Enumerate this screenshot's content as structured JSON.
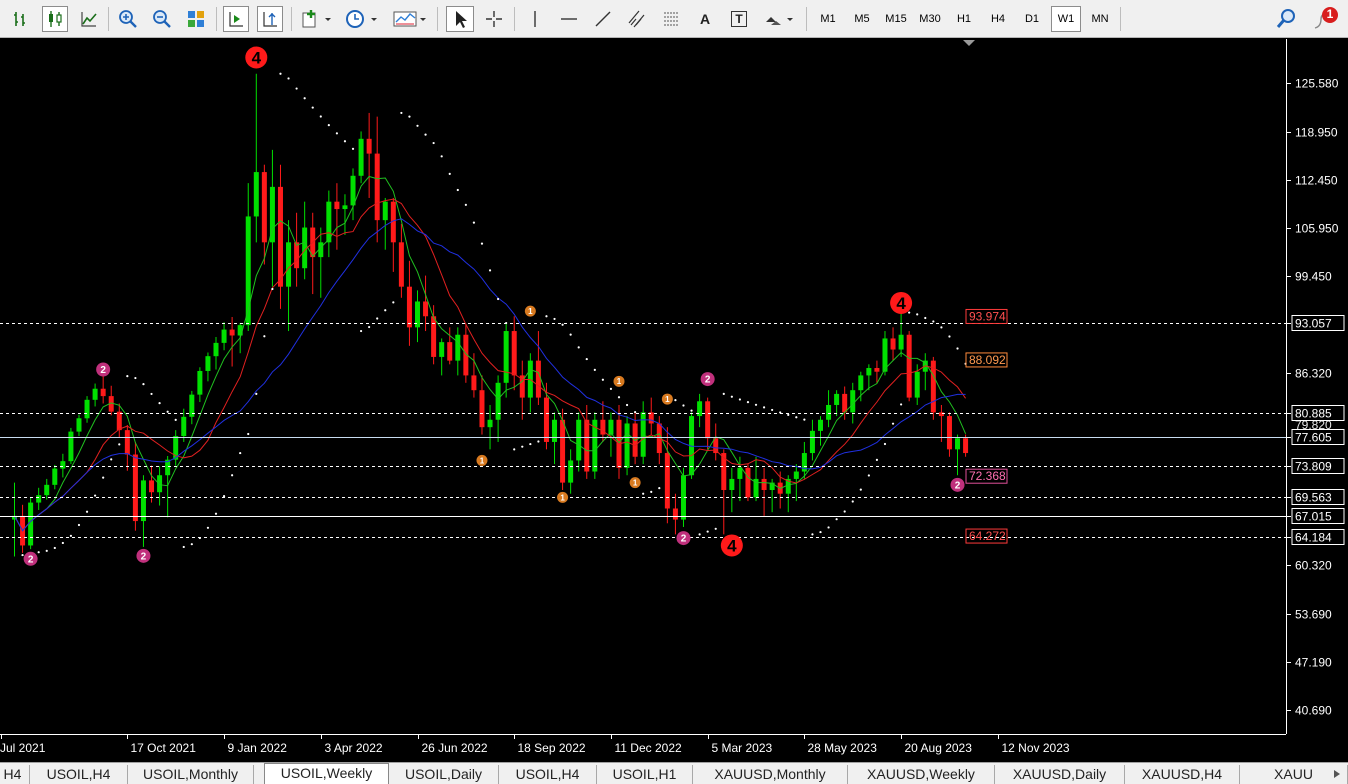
{
  "timeframes": [
    "M1",
    "M5",
    "M15",
    "M30",
    "H1",
    "H4",
    "D1",
    "W1",
    "MN"
  ],
  "active_timeframe": "W1",
  "toolbar_text": {
    "text_tool": "A",
    "label_tool": "T"
  },
  "notification_count": "1",
  "icons": [
    "bar-chart-icon",
    "candlestick-icon",
    "line-chart-icon",
    "zoom-in-icon",
    "zoom-out-icon",
    "tile-windows-icon",
    "autoscroll-icon",
    "chart-shift-icon",
    "indicators-icon",
    "periods-icon",
    "templates-icon",
    "cursor-icon",
    "crosshair-icon",
    "vertical-line-icon",
    "horizontal-line-icon",
    "trendline-icon",
    "equidistant-channel-icon",
    "fibonacci-icon",
    "text-icon",
    "label-icon",
    "arrows-icon",
    "search-icon",
    "notification-icon"
  ],
  "tabs": [
    {
      "label": "H4"
    },
    {
      "label": "USOIL,H4"
    },
    {
      "label": "USOIL,Monthly"
    },
    {
      "label": "USOIL,Weekly"
    },
    {
      "label": "USOIL,Daily"
    },
    {
      "label": "USOIL,H4"
    },
    {
      "label": "USOIL,H1"
    },
    {
      "label": "XAUUSD,Monthly"
    },
    {
      "label": "XAUUSD,Weekly"
    },
    {
      "label": "XAUUSD,Daily"
    },
    {
      "label": "XAUUSD,H4"
    },
    {
      "label": "XAUU"
    }
  ],
  "active_tab": 3,
  "chart_data": {
    "type": "candlestick",
    "symbol": "USOIL",
    "timeframe": "Weekly",
    "y_ticks": [
      "125.580",
      "118.950",
      "112.450",
      "105.950",
      "99.450",
      "86.320",
      "60.320",
      "53.690",
      "47.190",
      "40.690"
    ],
    "x_ticks": [
      {
        "label": "Jul 2021",
        "week": 0
      },
      {
        "label": "17 Oct 2021",
        "week": 14
      },
      {
        "label": "9 Jan 2022",
        "week": 26
      },
      {
        "label": "3 Apr 2022",
        "week": 38
      },
      {
        "label": "26 Jun 2022",
        "week": 50
      },
      {
        "label": "18 Sep 2022",
        "week": 62
      },
      {
        "label": "11 Dec 2022",
        "week": 74
      },
      {
        "label": "5 Mar 2023",
        "week": 86
      },
      {
        "label": "28 May 2023",
        "week": 98
      },
      {
        "label": "20 Aug 2023",
        "week": 110
      },
      {
        "label": "12 Nov 2023",
        "week": 122
      }
    ],
    "ylim": [
      37.5,
      131.5
    ],
    "horizontal_lines": [
      {
        "price": 93.057,
        "label": "93.057",
        "style": "dashed",
        "color": "#ffffff"
      },
      {
        "price": 80.885,
        "label": "80.885",
        "style": "dashed",
        "color": "#ffffff"
      },
      {
        "price": 77.605,
        "label": "77.605",
        "style": "solid",
        "color": "#c8dcf0"
      },
      {
        "price": 73.809,
        "label": "73.809",
        "style": "dashed",
        "color": "#ffffff"
      },
      {
        "price": 69.563,
        "label": "69.563",
        "style": "dashed",
        "color": "#ffffff"
      },
      {
        "price": 67.015,
        "label": "67.015",
        "style": "solid",
        "color": "#ffffff"
      },
      {
        "price": 64.184,
        "label": "64.184",
        "style": "dashed",
        "color": "#ffffff"
      }
    ],
    "hidden_axis_label": "79.820",
    "price_boxes": [
      {
        "price": 93.974,
        "label": "93.974",
        "color": "#ff3b3b",
        "text_color": "#ff5050"
      },
      {
        "price": 88.092,
        "label": "88.092",
        "color": "#ff8a3b",
        "text_color": "#ff9a50"
      },
      {
        "price": 72.368,
        "label": "72.368",
        "color": "#e0509a",
        "text_color": "#ff6fb0"
      },
      {
        "price": 64.272,
        "label": "64.272",
        "color": "#ff3b3b",
        "text_color": "#ff5050"
      }
    ],
    "wave_labels": [
      {
        "text": "4",
        "week": 30,
        "price": 129.0,
        "color": "#ff1a1a",
        "size": "large"
      },
      {
        "text": "4",
        "week": 110,
        "price": 95.8,
        "color": "#ff1a1a",
        "size": "large"
      },
      {
        "text": "4",
        "week": 89,
        "price": 63.0,
        "color": "#ff1a1a",
        "size": "large"
      },
      {
        "text": "2",
        "week": 11,
        "price": 86.8,
        "color": "#c0307c",
        "size": "small"
      },
      {
        "text": "2",
        "week": 2,
        "price": 61.2,
        "color": "#c0307c",
        "size": "small"
      },
      {
        "text": "2",
        "week": 16,
        "price": 61.6,
        "color": "#c0307c",
        "size": "small"
      },
      {
        "text": "2",
        "week": 86,
        "price": 85.5,
        "color": "#c0307c",
        "size": "small"
      },
      {
        "text": "2",
        "week": 83,
        "price": 64.0,
        "color": "#c0307c",
        "size": "small"
      },
      {
        "text": "2",
        "week": 117,
        "price": 71.2,
        "color": "#c0307c",
        "size": "small"
      },
      {
        "text": "1",
        "week": 64,
        "price": 94.7,
        "color": "#d87a20",
        "size": "tiny"
      },
      {
        "text": "1",
        "week": 58,
        "price": 74.5,
        "color": "#d87a20",
        "size": "tiny"
      },
      {
        "text": "1",
        "week": 75,
        "price": 85.2,
        "color": "#d87a20",
        "size": "tiny"
      },
      {
        "text": "1",
        "week": 81,
        "price": 82.8,
        "color": "#d87a20",
        "size": "tiny"
      },
      {
        "text": "1",
        "week": 77,
        "price": 71.5,
        "color": "#d87a20",
        "size": "tiny"
      },
      {
        "text": "1",
        "week": 68,
        "price": 69.5,
        "color": "#d87a20",
        "size": "tiny"
      }
    ],
    "candles": [
      [
        66.5,
        71.5,
        61.5,
        67.0
      ],
      [
        67.0,
        68.5,
        62.0,
        63.0
      ],
      [
        63.0,
        69.5,
        62.5,
        68.8
      ],
      [
        68.8,
        70.8,
        67.8,
        69.8
      ],
      [
        69.8,
        72.0,
        69.2,
        71.2
      ],
      [
        71.2,
        73.9,
        70.6,
        73.4
      ],
      [
        73.4,
        75.4,
        72.2,
        74.4
      ],
      [
        74.4,
        78.9,
        74.0,
        78.4
      ],
      [
        78.4,
        80.7,
        77.8,
        80.2
      ],
      [
        80.2,
        83.2,
        79.6,
        82.7
      ],
      [
        82.7,
        84.9,
        81.8,
        84.2
      ],
      [
        84.2,
        85.9,
        82.2,
        83.2
      ],
      [
        83.2,
        84.6,
        80.6,
        81.1
      ],
      [
        81.1,
        82.2,
        77.6,
        78.6
      ],
      [
        78.6,
        79.3,
        73.1,
        75.3
      ],
      [
        75.3,
        77.0,
        65.0,
        66.3
      ],
      [
        66.3,
        72.5,
        62.8,
        71.8
      ],
      [
        71.8,
        73.8,
        68.8,
        70.2
      ],
      [
        70.2,
        73.7,
        68.4,
        72.5
      ],
      [
        72.5,
        75.1,
        66.8,
        74.6
      ],
      [
        74.6,
        78.6,
        73.8,
        77.8
      ],
      [
        77.8,
        81.5,
        77.0,
        80.4
      ],
      [
        80.4,
        83.9,
        79.4,
        83.4
      ],
      [
        83.4,
        87.1,
        82.4,
        86.6
      ],
      [
        86.6,
        89.1,
        85.2,
        88.6
      ],
      [
        88.6,
        91.2,
        86.8,
        90.4
      ],
      [
        90.4,
        93.2,
        89.4,
        92.2
      ],
      [
        92.2,
        93.9,
        87.2,
        91.4
      ],
      [
        91.4,
        93.1,
        89.0,
        92.8
      ],
      [
        92.8,
        112.0,
        92.0,
        107.5
      ],
      [
        107.5,
        126.8,
        104.0,
        113.5
      ],
      [
        113.5,
        114.5,
        101.0,
        104.0
      ],
      [
        104.0,
        116.5,
        98.0,
        111.5
      ],
      [
        111.5,
        114.5,
        95.0,
        98.0
      ],
      [
        98.0,
        107.0,
        92.0,
        104.0
      ],
      [
        104.0,
        108.0,
        98.0,
        100.5
      ],
      [
        100.5,
        109.5,
        99.0,
        106.0
      ],
      [
        106.0,
        108.0,
        97.0,
        102.0
      ],
      [
        102.0,
        106.0,
        96.5,
        104.0
      ],
      [
        104.0,
        111.0,
        102.0,
        109.5
      ],
      [
        109.5,
        112.0,
        103.0,
        108.5
      ],
      [
        108.5,
        110.5,
        105.0,
        109.0
      ],
      [
        109.0,
        114.0,
        107.0,
        113.0
      ],
      [
        113.0,
        119.0,
        112.0,
        118.0
      ],
      [
        118.0,
        121.5,
        110.0,
        116.0
      ],
      [
        116.0,
        121.0,
        104.0,
        107.0
      ],
      [
        107.0,
        110.0,
        103.0,
        109.5
      ],
      [
        109.5,
        110.0,
        100.0,
        104.0
      ],
      [
        104.0,
        106.5,
        96.5,
        98.0
      ],
      [
        98.0,
        101.5,
        90.0,
        92.5
      ],
      [
        92.5,
        97.5,
        90.5,
        96.0
      ],
      [
        96.0,
        99.5,
        92.0,
        94.0
      ],
      [
        94.0,
        95.5,
        87.5,
        88.5
      ],
      [
        88.5,
        91.0,
        86.0,
        90.5
      ],
      [
        90.5,
        92.5,
        87.5,
        88.0
      ],
      [
        88.0,
        92.5,
        86.0,
        91.5
      ],
      [
        91.5,
        93.0,
        85.0,
        86.0
      ],
      [
        86.0,
        89.0,
        83.0,
        84.0
      ],
      [
        84.0,
        86.0,
        78.0,
        79.0
      ],
      [
        79.0,
        82.0,
        76.0,
        80.0
      ],
      [
        80.0,
        86.0,
        77.0,
        85.0
      ],
      [
        85.0,
        93.0,
        83.0,
        92.0
      ],
      [
        92.0,
        94.0,
        84.0,
        86.0
      ],
      [
        86.0,
        88.0,
        80.0,
        83.0
      ],
      [
        83.0,
        89.0,
        81.0,
        88.0
      ],
      [
        88.0,
        92.0,
        82.0,
        83.0
      ],
      [
        83.0,
        85.0,
        76.0,
        77.0
      ],
      [
        77.0,
        81.0,
        74.0,
        80.0
      ],
      [
        80.0,
        81.5,
        70.5,
        71.5
      ],
      [
        71.5,
        76.0,
        70.0,
        74.5
      ],
      [
        74.5,
        81.0,
        73.0,
        80.0
      ],
      [
        80.0,
        82.0,
        72.0,
        73.0
      ],
      [
        73.0,
        81.0,
        72.0,
        80.0
      ],
      [
        80.0,
        82.5,
        77.0,
        78.0
      ],
      [
        78.0,
        81.0,
        75.0,
        80.0
      ],
      [
        80.0,
        82.0,
        72.0,
        73.5
      ],
      [
        73.5,
        80.5,
        72.5,
        79.5
      ],
      [
        79.5,
        81.0,
        74.0,
        75.0
      ],
      [
        75.0,
        82.5,
        74.0,
        81.0
      ],
      [
        81.0,
        83.0,
        78.0,
        79.5
      ],
      [
        79.5,
        80.5,
        74.0,
        75.5
      ],
      [
        75.5,
        79.0,
        66.0,
        68.0
      ],
      [
        68.0,
        70.0,
        64.5,
        66.5
      ],
      [
        66.5,
        73.5,
        65.5,
        72.5
      ],
      [
        72.5,
        81.0,
        72.0,
        80.5
      ],
      [
        80.5,
        83.5,
        79.0,
        82.5
      ],
      [
        82.5,
        83.0,
        76.0,
        77.5
      ],
      [
        77.5,
        79.5,
        74.5,
        75.5
      ],
      [
        75.5,
        76.0,
        64.5,
        70.5
      ],
      [
        70.5,
        73.5,
        67.5,
        72.0
      ],
      [
        72.0,
        75.0,
        69.0,
        73.5
      ],
      [
        73.5,
        74.0,
        69.0,
        69.5
      ],
      [
        69.5,
        75.0,
        69.0,
        72.0
      ],
      [
        72.0,
        73.5,
        67.0,
        70.5
      ],
      [
        70.5,
        72.0,
        67.5,
        71.5
      ],
      [
        71.5,
        73.0,
        68.0,
        70.0
      ],
      [
        70.0,
        72.5,
        67.5,
        72.0
      ],
      [
        72.0,
        74.0,
        69.0,
        73.0
      ],
      [
        73.0,
        77.0,
        72.0,
        75.5
      ],
      [
        75.5,
        80.0,
        74.5,
        78.5
      ],
      [
        78.5,
        80.5,
        76.5,
        80.0
      ],
      [
        80.0,
        84.0,
        79.0,
        82.0
      ],
      [
        82.0,
        84.0,
        80.5,
        83.5
      ],
      [
        83.5,
        84.5,
        80.0,
        81.0
      ],
      [
        81.0,
        85.0,
        79.5,
        84.0
      ],
      [
        84.0,
        86.5,
        82.5,
        86.0
      ],
      [
        86.0,
        87.5,
        84.0,
        87.0
      ],
      [
        87.0,
        88.0,
        85.0,
        86.5
      ],
      [
        86.5,
        92.0,
        86.0,
        91.0
      ],
      [
        91.0,
        92.5,
        88.0,
        89.5
      ],
      [
        89.5,
        94.5,
        88.5,
        91.5
      ],
      [
        91.5,
        92.0,
        82.5,
        83.0
      ],
      [
        83.0,
        87.5,
        82.0,
        86.5
      ],
      [
        86.5,
        89.0,
        84.0,
        88.0
      ],
      [
        88.0,
        88.5,
        80.0,
        81.0
      ],
      [
        81.0,
        82.0,
        77.0,
        80.5
      ],
      [
        80.5,
        81.0,
        75.0,
        76.0
      ],
      [
        76.0,
        78.0,
        72.5,
        77.5
      ],
      [
        77.5,
        78.0,
        75.0,
        75.5
      ]
    ],
    "moving_averages": [
      {
        "name": "fast",
        "color": "#20c020",
        "period": 5
      },
      {
        "name": "medium",
        "color": "#e02020",
        "period": 10
      },
      {
        "name": "slow",
        "color": "#2030e0",
        "period": 20
      }
    ]
  }
}
